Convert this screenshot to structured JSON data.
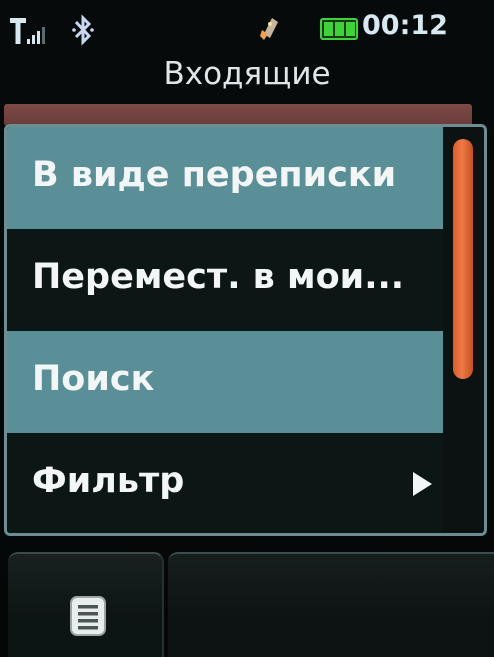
{
  "status_bar": {
    "time": "00:12",
    "icons": [
      "signal-icon",
      "bluetooth-icon",
      "recording-icon",
      "battery-icon"
    ],
    "battery_color": "#3fd23a"
  },
  "header": {
    "title": "Входящие"
  },
  "menu": {
    "items": [
      {
        "label": "В виде переписки",
        "style": "light",
        "has_submenu": false
      },
      {
        "label": "Перемест. в мои...",
        "style": "dark",
        "has_submenu": false
      },
      {
        "label": "Поиск",
        "style": "light",
        "has_submenu": false
      },
      {
        "label": "Фильтр",
        "style": "dark",
        "has_submenu": true
      }
    ],
    "scrollbar_color": "#e86b36"
  },
  "softkeys": {
    "left_icon": "list-menu-icon"
  },
  "colors": {
    "menu_item_light": "#5b8f97",
    "menu_item_dark": "#0b1615",
    "accent_strip": "#7c4a47"
  }
}
